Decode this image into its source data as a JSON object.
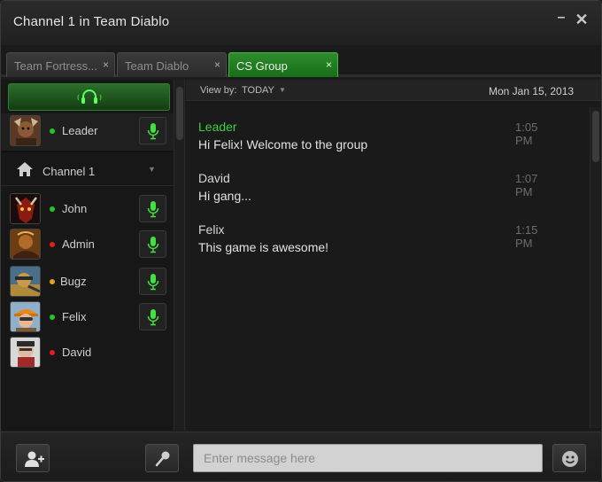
{
  "window": {
    "title": "Channel 1 in Team Diablo"
  },
  "tabs": [
    {
      "label": "Team Fortress...",
      "active": false
    },
    {
      "label": "Team Diablo",
      "active": false
    },
    {
      "label": "CS Group",
      "active": true
    }
  ],
  "tab_close_glyph": "×",
  "leader": {
    "name": "Leader",
    "status": "online"
  },
  "channel": {
    "label": "Channel 1"
  },
  "members": [
    {
      "name": "John",
      "status": "online",
      "mic": true
    },
    {
      "name": "Admin",
      "status": "busy",
      "mic": true
    },
    {
      "name": "Bugz",
      "status": "away",
      "mic": true
    },
    {
      "name": "Felix",
      "status": "online",
      "mic": true
    },
    {
      "name": "David",
      "status": "busy",
      "mic": false
    }
  ],
  "view": {
    "label": "View by:",
    "value": "TODAY",
    "date": "Mon Jan 15, 2013"
  },
  "messages": [
    {
      "sender": "Leader",
      "time": "1:05 PM",
      "text": "Hi Felix! Welcome to the group"
    },
    {
      "sender": "David",
      "time": "1:07 PM",
      "text": "Hi gang..."
    },
    {
      "sender": "Felix",
      "time": "1:15 PM",
      "text": "This game is awesome!"
    }
  ],
  "input": {
    "placeholder": "Enter message here"
  },
  "colors": {
    "accent_green": "#3fcf3f",
    "status_online": "#22c722",
    "status_busy": "#e02020",
    "status_away": "#e0a020"
  },
  "icons": {
    "voice": "headset-icon",
    "mic": "microphone-icon",
    "channel": "home-icon",
    "add_user": "add-user-icon",
    "push_to_talk": "microphone-icon",
    "emoji": "smiley-icon"
  }
}
